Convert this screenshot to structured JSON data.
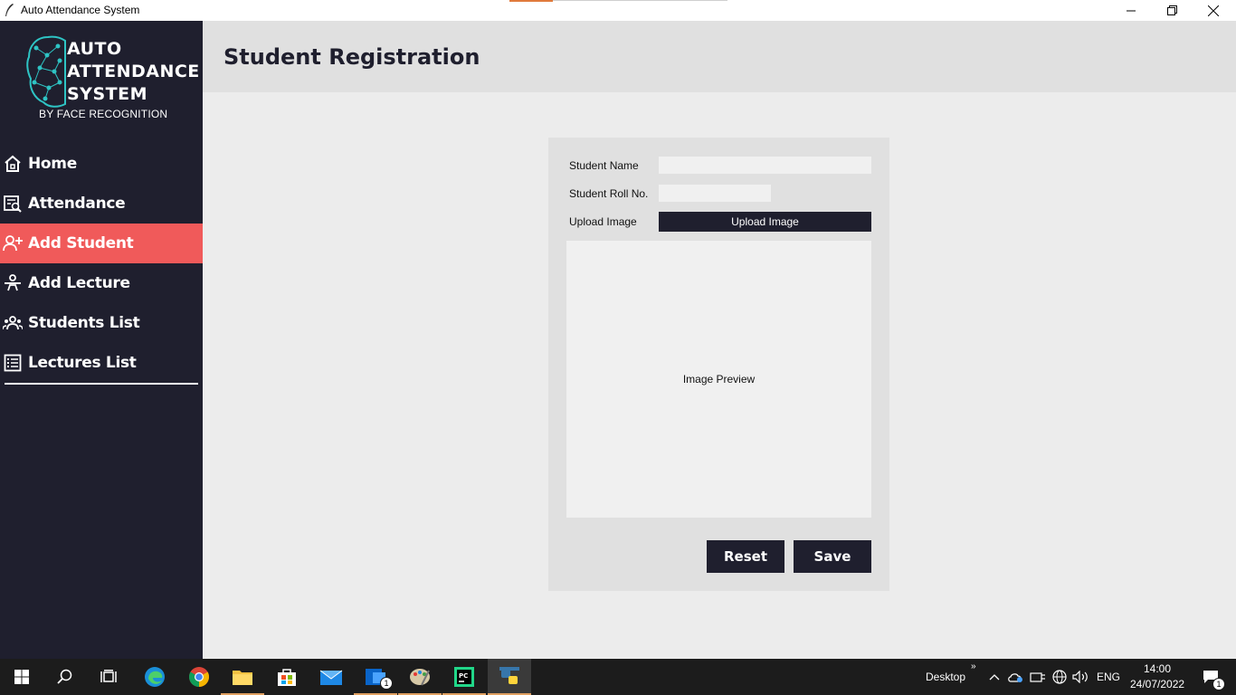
{
  "window": {
    "title": "Auto Attendance System"
  },
  "logo": {
    "line1": "AUTO",
    "line2": "ATTENDANCE",
    "line3": "SYSTEM",
    "subtitle": "BY FACE RECOGNITION"
  },
  "sidebar": {
    "items": [
      {
        "label": "Home",
        "icon": "home-icon",
        "active": false
      },
      {
        "label": "Attendance",
        "icon": "attendance-search-icon",
        "active": false
      },
      {
        "label": "Add Student",
        "icon": "add-user-icon",
        "active": true
      },
      {
        "label": "Add Lecture",
        "icon": "lecture-icon",
        "active": false
      },
      {
        "label": "Students List",
        "icon": "group-icon",
        "active": false
      },
      {
        "label": "Lectures List",
        "icon": "list-icon",
        "active": false
      }
    ]
  },
  "header": {
    "title": "Student Registration"
  },
  "form": {
    "name_label": "Student Name",
    "name_value": "",
    "roll_label": "Student Roll No.",
    "roll_value": "",
    "upload_label": "Upload Image",
    "upload_button": "Upload Image",
    "preview_text": "Image Preview",
    "reset_button": "Reset",
    "save_button": "Save"
  },
  "taskbar": {
    "desktop_label": "Desktop",
    "language": "ENG",
    "time": "14:00",
    "date": "24/07/2022",
    "mail_badge": "1",
    "notification_badge": "1"
  },
  "colors": {
    "sidebar_bg": "#1f1f2e",
    "active_item": "#f05a5a",
    "header_bg": "#e0e0e0",
    "button_bg": "#1f1f2e"
  }
}
